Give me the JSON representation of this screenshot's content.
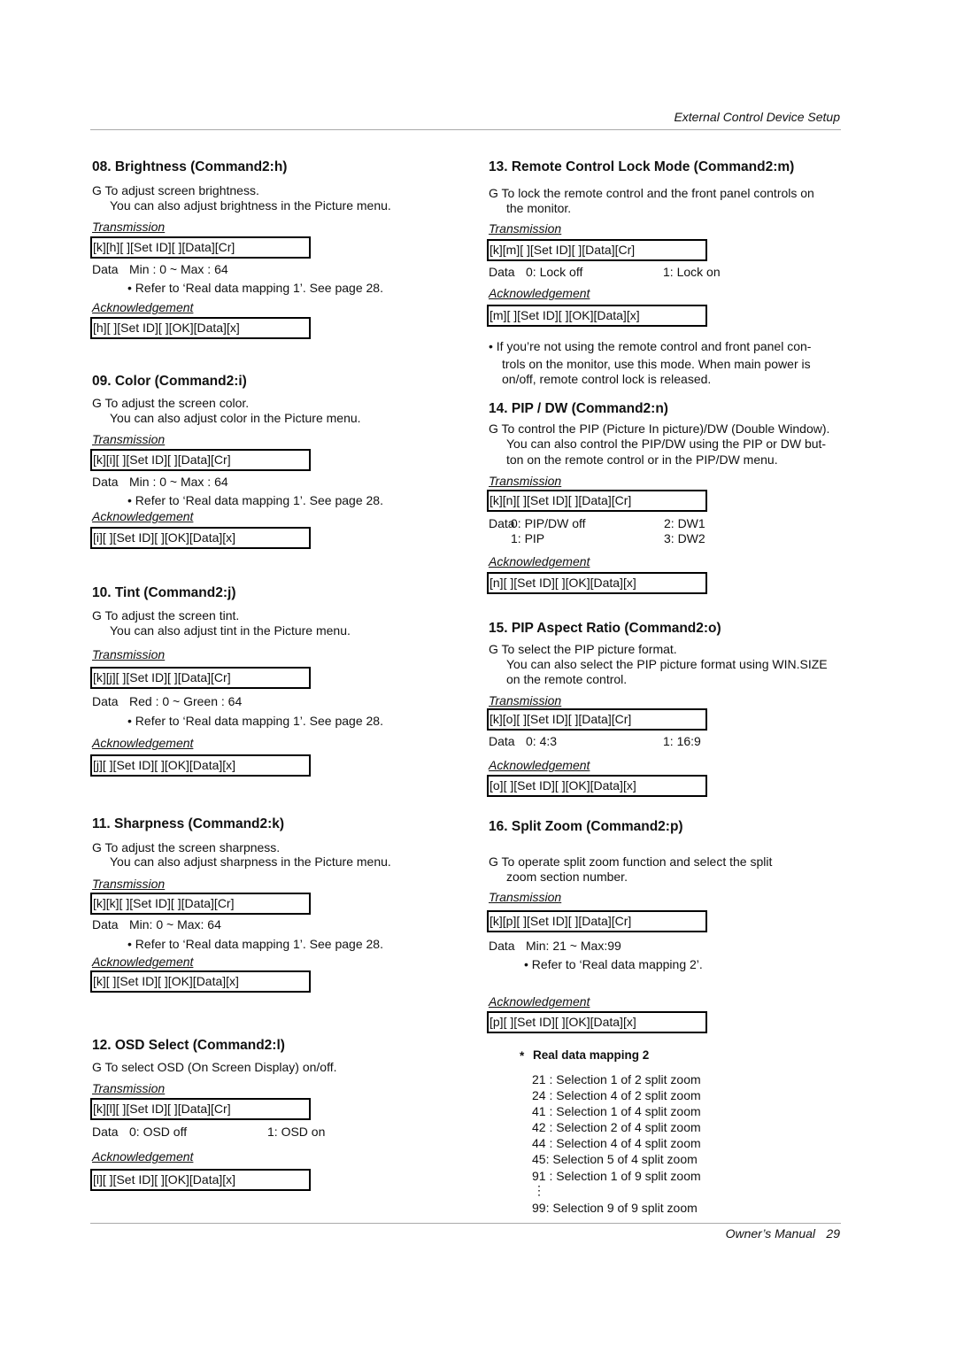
{
  "header": {
    "title": "External Control Device Setup"
  },
  "footer": {
    "label": "Owner’s Manual",
    "page": "29"
  },
  "sections": [
    {
      "title": "08. Brightness (Command2:h)",
      "desc": [
        "G  To adjust screen brightness.",
        "You can also adjust brightness in the Picture menu."
      ],
      "transmission_label": "Transmission",
      "transmission_code": "[k][h][  ][Set ID][  ][Data][Cr]",
      "data": [
        {
          "label": "Data",
          "left": "Min : 0 ~ Max : 64",
          "right": ""
        }
      ],
      "notes": [
        "• Refer to ‘Real data mapping 1’. See page 28."
      ],
      "ack_label": "Acknowledgement",
      "ack_code": "[h][  ][Set ID][  ][OK][Data][x]"
    },
    {
      "title": "09. Color (Command2:i)",
      "desc": [
        "G  To adjust the screen color.",
        "You can also adjust color in the Picture menu."
      ],
      "transmission_label": "Transmission",
      "transmission_code": "[k][i][  ][Set ID][  ][Data][Cr]",
      "data": [
        {
          "label": "Data",
          "left": "Min : 0 ~ Max : 64",
          "right": ""
        }
      ],
      "notes": [
        "• Refer to ‘Real data mapping 1’. See page 28."
      ],
      "ack_label": "Acknowledgement",
      "ack_code": "[i][  ][Set ID][  ][OK][Data][x]"
    },
    {
      "title": "10. Tint (Command2:j)",
      "desc": [
        "G  To adjust the screen tint.",
        "You can also adjust tint in the Picture menu."
      ],
      "transmission_label": "Transmission",
      "transmission_code": "[k][j][  ][Set ID][  ][Data][Cr]",
      "data": [
        {
          "label": "Data",
          "left": "Red : 0 ~ Green : 64",
          "right": ""
        }
      ],
      "notes": [
        "• Refer to ‘Real data mapping 1’. See page 28."
      ],
      "ack_label": "Acknowledgement",
      "ack_code": "[j][  ][Set ID][  ][OK][Data][x]"
    },
    {
      "title": "11. Sharpness (Command2:k)",
      "desc": [
        "G  To adjust the screen sharpness.",
        "You can also adjust sharpness in the Picture menu."
      ],
      "transmission_label": "Transmission",
      "transmission_code": "[k][k][  ][Set ID][  ][Data][Cr]",
      "data": [
        {
          "label": "Data",
          "left": "Min: 0 ~ Max: 64",
          "right": ""
        }
      ],
      "notes": [
        "• Refer to ‘Real data mapping 1’. See page 28."
      ],
      "ack_label": "Acknowledgement",
      "ack_code": "[k][  ][Set ID][  ][OK][Data][x]"
    },
    {
      "title": "12. OSD Select (Command2:l)",
      "desc": [
        "G  To select OSD (On Screen Display) on/off."
      ],
      "transmission_label": "Transmission",
      "transmission_code": "[k][l][  ][Set ID][  ][Data][Cr]",
      "data": [
        {
          "label": "Data",
          "left": "0: OSD off",
          "right": "1: OSD on"
        }
      ],
      "notes": [],
      "ack_label": "Acknowledgement",
      "ack_code": "[l][  ][Set ID][  ][OK][Data][x]"
    },
    {
      "title": "13. Remote Control Lock Mode (Command2:m)",
      "desc": [
        "G  To lock the remote control and the front panel controls on",
        "the monitor."
      ],
      "transmission_label": "Transmission",
      "transmission_code": "[k][m][  ][Set ID][  ][Data][Cr]",
      "data": [
        {
          "label": "Data",
          "left": "0: Lock off",
          "right": "1: Lock on"
        }
      ],
      "notes": [
        "• If you’re not using the remote control and front panel con-",
        "trols on the monitor, use this mode. When main power is",
        "on/off, remote control lock is released."
      ],
      "ack_label": "Acknowledgement",
      "ack_code": "[m][  ][Set ID][  ][OK][Data][x]"
    },
    {
      "title": "14. PIP / DW (Command2:n)",
      "desc": [
        "G  To control the PIP (Picture In picture)/DW (Double Window).",
        "You can also control the PIP/DW using the PIP or DW but-",
        "ton on the remote control or in the PIP/DW menu."
      ],
      "transmission_label": "Transmission",
      "transmission_code": "[k][n][  ][Set ID][  ][Data][Cr]",
      "data": [
        {
          "label": "Data",
          "left": "0: PIP/DW off",
          "right": "2: DW1"
        },
        {
          "label": "",
          "left": "1: PIP",
          "right": "3: DW2"
        }
      ],
      "notes": [],
      "ack_label": "Acknowledgement",
      "ack_code": "[n][  ][Set ID][  ][OK][Data][x]"
    },
    {
      "title": "15. PIP Aspect Ratio (Command2:o)",
      "desc": [
        "G  To select the PIP picture format.",
        "You can also select the PIP picture format using WIN.SIZE",
        "on the remote control."
      ],
      "transmission_label": "Transmission",
      "transmission_code": "[k][o][  ][Set ID][  ][Data][Cr]",
      "data": [
        {
          "label": "Data",
          "left": "0: 4:3",
          "right": "1: 16:9"
        }
      ],
      "notes": [],
      "ack_label": "Acknowledgement",
      "ack_code": "[o][  ][Set ID][  ][OK][Data][x]"
    },
    {
      "title": "16. Split Zoom (Command2:p)",
      "desc": [
        "G  To operate split zoom function and select the split",
        "zoom section number."
      ],
      "transmission_label": "Transmission",
      "transmission_code": "[k][p][  ][Set ID][  ][Data][Cr]",
      "data": [
        {
          "label": "Data",
          "left": "Min: 21 ~ Max:99",
          "right": ""
        }
      ],
      "notes": [
        "• Refer to ‘Real data mapping 2’."
      ],
      "ack_label": "Acknowledgement",
      "ack_code": "[p][  ][Set ID][  ][OK][Data][x]"
    }
  ],
  "mapping": {
    "title": "Real data mapping 2",
    "marker": "*",
    "rows": [
      "21 : Selection 1 of 2 split zoom",
      "24 : Selection 4 of 2 split zoom",
      "41 : Selection 1 of 4 split zoom",
      "42 : Selection 2 of 4 split zoom",
      "44 : Selection 4 of 4 split zoom",
      "45: Selection 5 of 4 split zoom",
      "91 : Selection 1 of 9 split zoom",
      "⋮",
      "99: Selection 9 of 9 split zoom"
    ]
  }
}
